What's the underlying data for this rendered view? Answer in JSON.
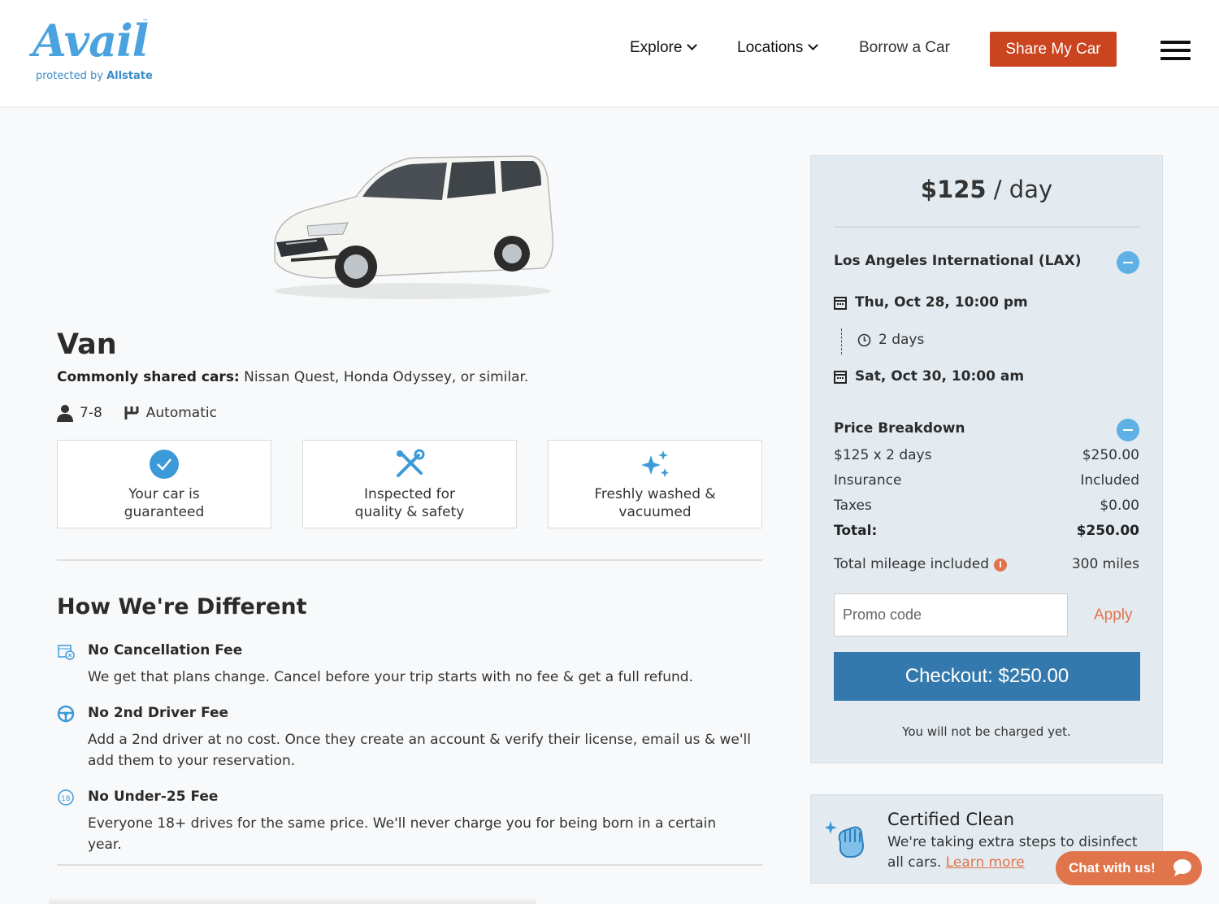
{
  "header": {
    "logo_text": "Avail",
    "logo_sub_prefix": "protected by",
    "logo_sub_brand": "Allstate",
    "nav": {
      "explore": "Explore",
      "locations": "Locations",
      "borrow": "Borrow a Car"
    },
    "share_button": "Share My Car",
    "menu_icon": "hamburger-menu-icon"
  },
  "vehicle": {
    "type": "Van",
    "common_label": "Commonly shared cars:",
    "common_value": "Nissan Quest, Honda Odyssey, or similar.",
    "seats": "7-8",
    "transmission": "Automatic",
    "features": [
      {
        "icon": "check-circle-icon",
        "line1": "Your car is",
        "line2": "guaranteed"
      },
      {
        "icon": "tools-icon",
        "line1": "Inspected for",
        "line2": "quality & safety"
      },
      {
        "icon": "sparkles-icon",
        "line1": "Freshly washed &",
        "line2": "vacuumed"
      }
    ]
  },
  "how_different": {
    "title": "How We're Different",
    "items": [
      {
        "icon": "calendar-cancel-icon",
        "title": "No Cancellation Fee",
        "desc": "We get that plans change. Cancel before your trip starts with no fee & get a full refund."
      },
      {
        "icon": "steering-wheel-icon",
        "title": "No 2nd Driver Fee",
        "desc": "Add a 2nd driver at no cost. Once they create an account & verify their license, email us & we'll add them to your reservation."
      },
      {
        "icon": "age-18-plus-icon",
        "title": "No Under-25 Fee",
        "desc": "Everyone 18+ drives for the same price. We'll never charge you for being born in a certain year."
      }
    ]
  },
  "booking": {
    "price_amount": "$125",
    "price_unit": " / day",
    "location": "Los Angeles International (LAX)",
    "pickup": "Thu, Oct 28, 10:00 pm",
    "duration": "2 days",
    "dropoff": "Sat, Oct 30, 10:00 am",
    "breakdown_title": "Price Breakdown",
    "rows": [
      {
        "label": "$125 x 2 days",
        "value": "$250.00"
      },
      {
        "label": "Insurance",
        "value": "Included"
      },
      {
        "label": "Taxes",
        "value": "$0.00"
      },
      {
        "label": "Total:",
        "value": "$250.00"
      }
    ],
    "mileage_label": "Total mileage included",
    "mileage_value": "300 miles",
    "promo_placeholder": "Promo code",
    "apply": "Apply",
    "checkout": "Checkout:  $250.00",
    "no_charge": "You will not be charged yet."
  },
  "clean": {
    "title": "Certified Clean",
    "desc": "We're taking extra steps to disinfect all cars.",
    "link": "Learn more"
  },
  "chat": "Chat with us!",
  "colors": {
    "brand_blue": "#4aa3df",
    "cta_orange": "#c9441f",
    "checkout_blue": "#3479ad",
    "accent_orange": "#e0744a"
  }
}
